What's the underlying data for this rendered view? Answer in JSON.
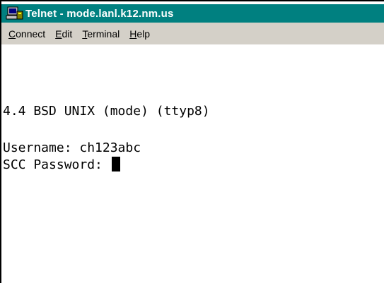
{
  "window": {
    "title": "Telnet - mode.lanl.k12.nm.us",
    "title_color": "#ffffff",
    "titlebar_color": "#008080",
    "icon": "telnet-computer-icon"
  },
  "menu": {
    "items": [
      {
        "key": "C",
        "rest": "onnect"
      },
      {
        "key": "E",
        "rest": "dit"
      },
      {
        "key": "T",
        "rest": "erminal"
      },
      {
        "key": "H",
        "rest": "elp"
      }
    ]
  },
  "terminal": {
    "banner": "4.4 BSD UNIX (mode) (ttyp8)",
    "username_line": "Username: ch123abc",
    "password_prompt": "SCC Password: "
  }
}
